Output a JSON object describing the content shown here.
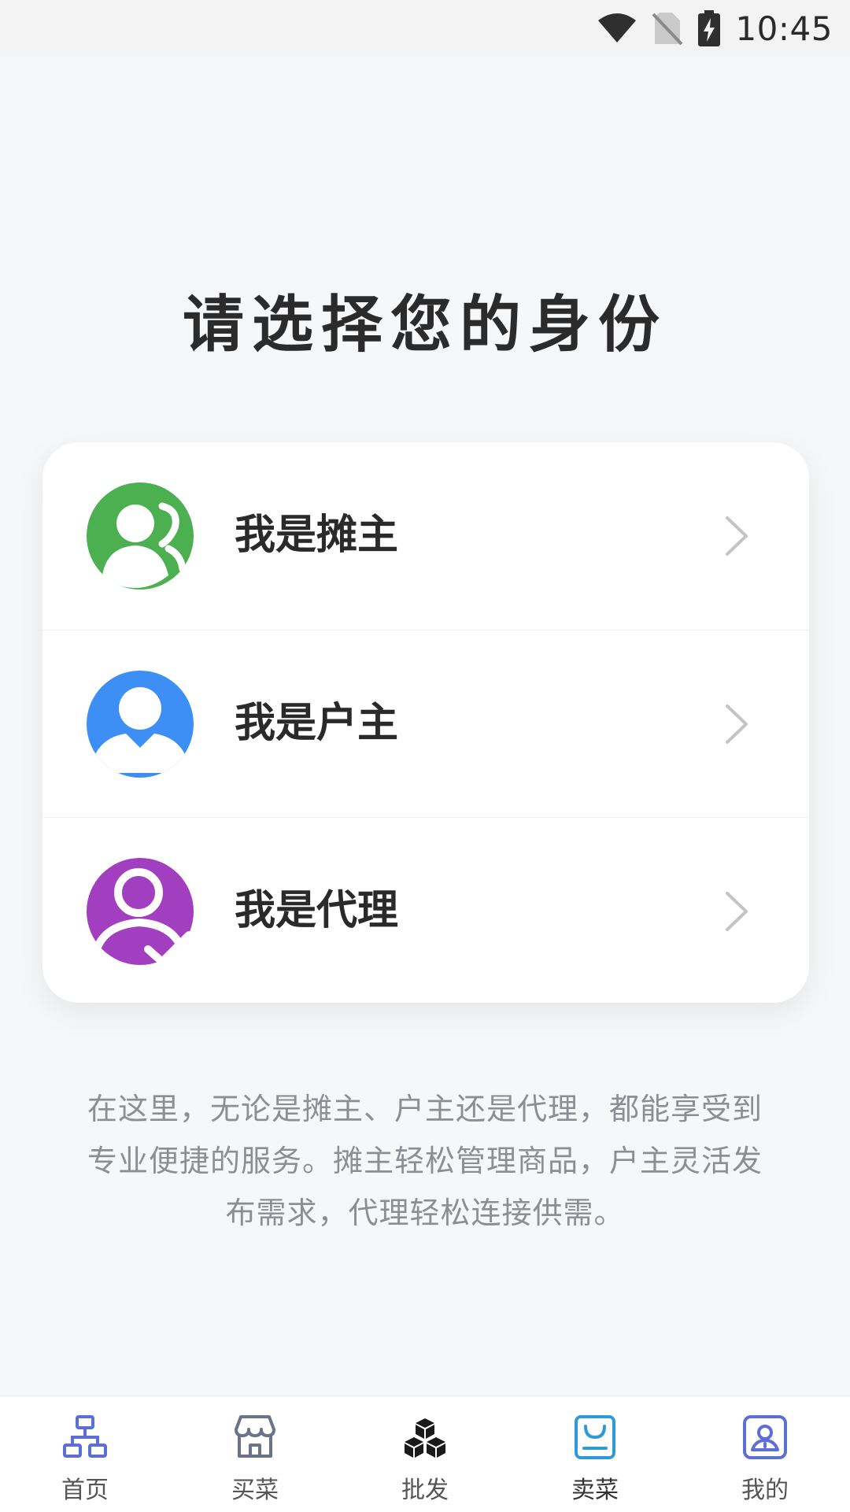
{
  "status_bar": {
    "time": "10:45",
    "icons": [
      "wifi-icon",
      "no-sim-icon",
      "battery-charging-icon"
    ]
  },
  "page": {
    "title": "请选择您的身份"
  },
  "roles": [
    {
      "label": "我是摊主",
      "icon": "vendor-avatar-icon",
      "color": "#4caf50"
    },
    {
      "label": "我是户主",
      "icon": "householder-avatar-icon",
      "color": "#3d8ef5"
    },
    {
      "label": "我是代理",
      "icon": "agent-avatar-icon",
      "color": "#a23fc0"
    }
  ],
  "description": "在这里，无论是摊主、户主还是代理，都能享受到专业便捷的服务。摊主轻松管理商品，户主灵活发布需求，代理轻松连接供需。",
  "bottom_nav": {
    "items": [
      {
        "label": "首页",
        "icon": "home-network-icon",
        "color": "#5b6fd6"
      },
      {
        "label": "买菜",
        "icon": "store-icon",
        "color": "#6b7388"
      },
      {
        "label": "批发",
        "icon": "boxes-icon",
        "color": "#1a1a1a"
      },
      {
        "label": "卖菜",
        "icon": "bag-icon",
        "color": "#2f9ad8",
        "active": true
      },
      {
        "label": "我的",
        "icon": "user-profile-icon",
        "color": "#5b6fd6"
      }
    ]
  },
  "colors": {
    "background": "#f6f7f9",
    "card": "#ffffff",
    "description_text": "#8b8f94"
  }
}
